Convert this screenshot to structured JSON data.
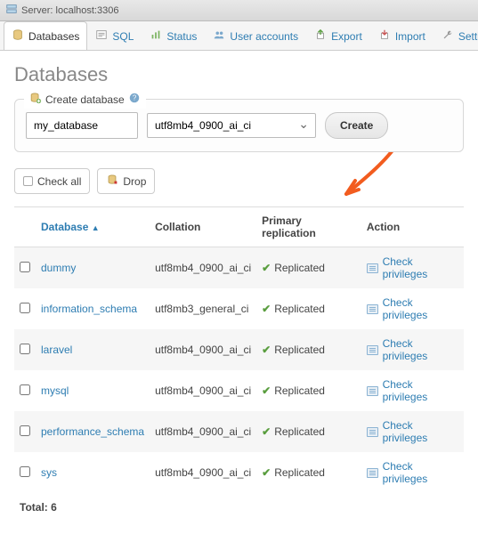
{
  "titlebar": {
    "label": "Server: localhost:3306"
  },
  "tabs": [
    {
      "label": "Databases",
      "active": true
    },
    {
      "label": "SQL"
    },
    {
      "label": "Status"
    },
    {
      "label": "User accounts"
    },
    {
      "label": "Export"
    },
    {
      "label": "Import"
    },
    {
      "label": "Settings"
    }
  ],
  "heading": "Databases",
  "create": {
    "legend": "Create database",
    "name_value": "my_database",
    "collation_value": "utf8mb4_0900_ai_ci",
    "button": "Create"
  },
  "toolbar": {
    "check_all": "Check all",
    "drop": "Drop"
  },
  "columns": {
    "db": "Database",
    "coll": "Collation",
    "repl": "Primary replication",
    "action": "Action"
  },
  "rows": [
    {
      "name": "dummy",
      "coll": "utf8mb4_0900_ai_ci",
      "repl": "Replicated",
      "action": "Check privileges"
    },
    {
      "name": "information_schema",
      "coll": "utf8mb3_general_ci",
      "repl": "Replicated",
      "action": "Check privileges"
    },
    {
      "name": "laravel",
      "coll": "utf8mb4_0900_ai_ci",
      "repl": "Replicated",
      "action": "Check privileges"
    },
    {
      "name": "mysql",
      "coll": "utf8mb4_0900_ai_ci",
      "repl": "Replicated",
      "action": "Check privileges"
    },
    {
      "name": "performance_schema",
      "coll": "utf8mb4_0900_ai_ci",
      "repl": "Replicated",
      "action": "Check privileges"
    },
    {
      "name": "sys",
      "coll": "utf8mb4_0900_ai_ci",
      "repl": "Replicated",
      "action": "Check privileges"
    }
  ],
  "total": "Total: 6"
}
